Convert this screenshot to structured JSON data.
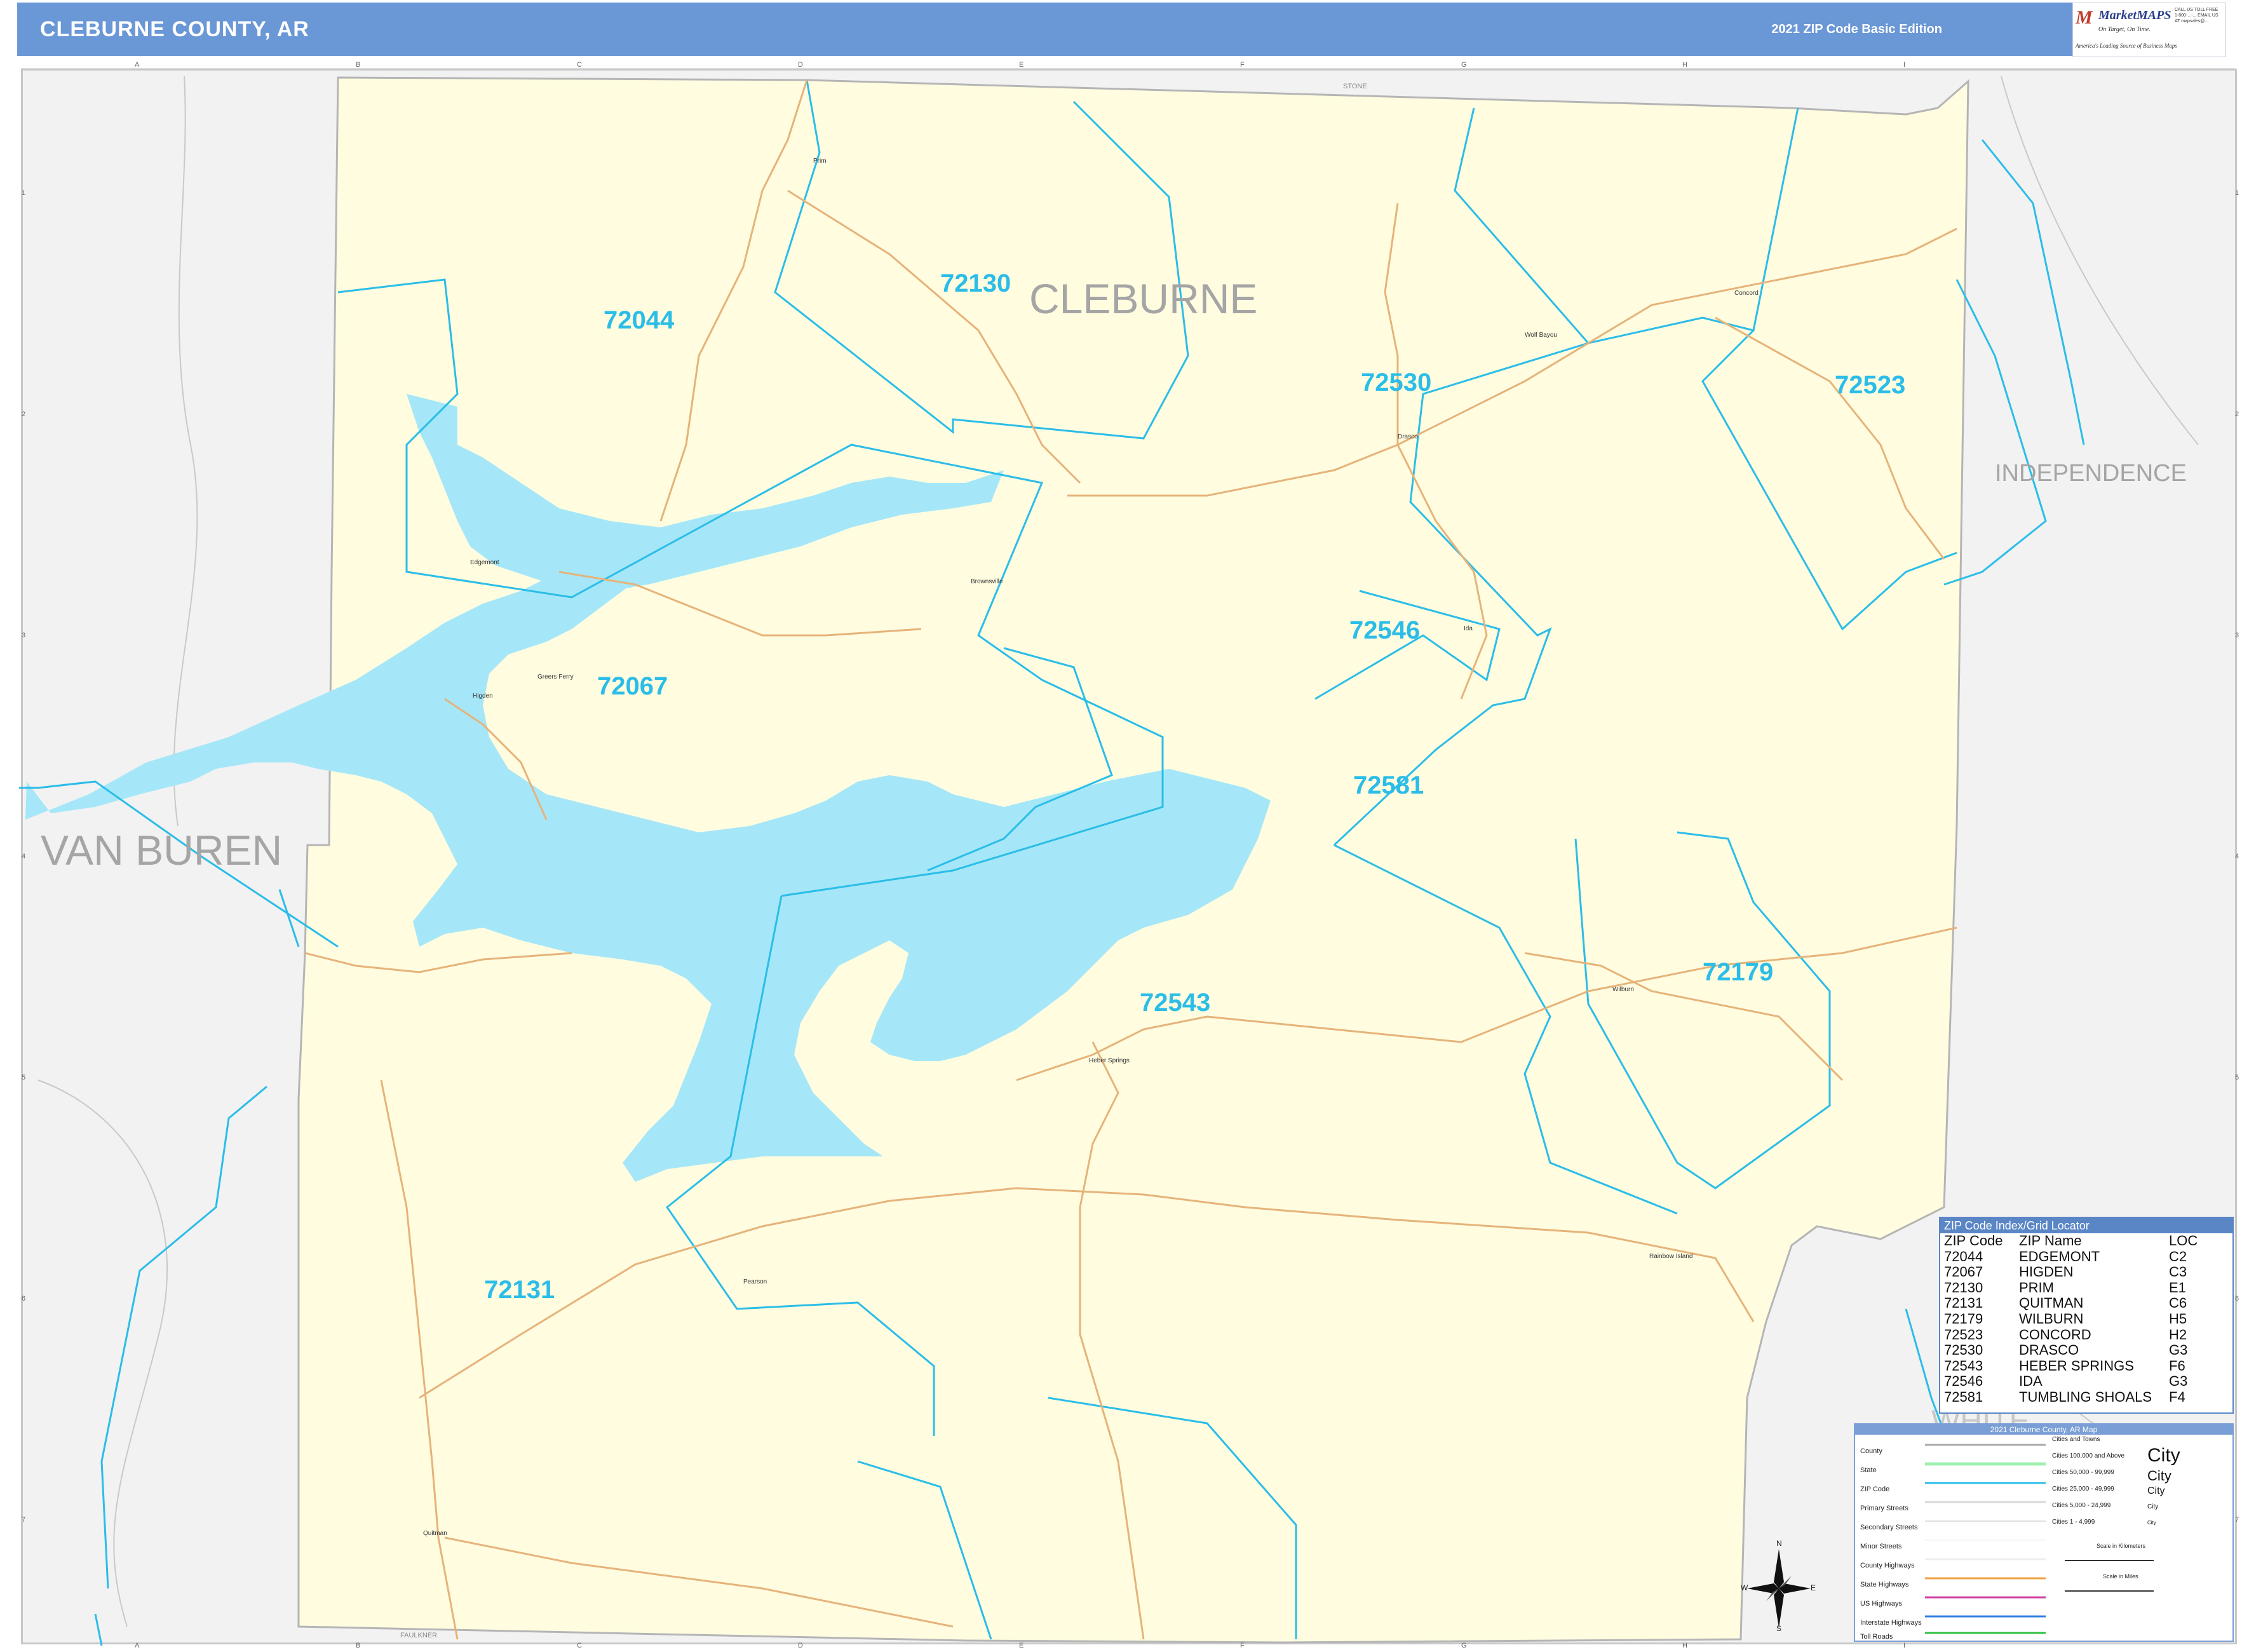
{
  "header": {
    "title": "CLEBURNE COUNTY, AR",
    "edition": "2021 ZIP Code Basic Edition"
  },
  "logo": {
    "brand": "MarketMAPS",
    "tagline": "On Target, On Time.",
    "tagline2": "America's Leading Source of Business Maps",
    "contact": "CALL US TOLL FREE 1-800-...-... EMAIL US AT mapsales@..."
  },
  "grid": {
    "columns": [
      "A",
      "B",
      "C",
      "D",
      "E",
      "F",
      "G",
      "H",
      "I"
    ],
    "rows": [
      "1",
      "2",
      "3",
      "4",
      "5",
      "6",
      "7"
    ]
  },
  "map": {
    "county_labels": {
      "main": "CLEBURNE",
      "west": "VAN BUREN",
      "east": "INDEPENDENCE",
      "southeast": "WHITE"
    },
    "border_labels": {
      "north": "STONE",
      "south": "FAULKNER"
    },
    "zip_labels": [
      "72044",
      "72130",
      "72530",
      "72523",
      "72067",
      "72546",
      "72581",
      "72543",
      "72179",
      "72131"
    ],
    "places": [
      "Prim",
      "Concord",
      "Wolf Bayou",
      "Drasco",
      "Edgemont",
      "Brownsville",
      "Ida",
      "Greers Ferry",
      "Higden",
      "Wilburn",
      "Heber Springs",
      "Pearson",
      "Rainbow Island",
      "Quitman"
    ]
  },
  "zip_index": {
    "title": "ZIP Code Index/Grid Locator",
    "headers": [
      "ZIP Code",
      "ZIP Name",
      "LOC"
    ],
    "rows": [
      [
        "72044",
        "EDGEMONT",
        "C2"
      ],
      [
        "72067",
        "HIGDEN",
        "C3"
      ],
      [
        "72130",
        "PRIM",
        "E1"
      ],
      [
        "72131",
        "QUITMAN",
        "C6"
      ],
      [
        "72179",
        "WILBURN",
        "H5"
      ],
      [
        "72523",
        "CONCORD",
        "H2"
      ],
      [
        "72530",
        "DRASCO",
        "G3"
      ],
      [
        "72543",
        "HEBER SPRINGS",
        "F6"
      ],
      [
        "72546",
        "IDA",
        "G3"
      ],
      [
        "72581",
        "TUMBLING SHOALS",
        "F4"
      ]
    ]
  },
  "legend": {
    "title": "2021 Cleburne County, AR Map",
    "items": [
      "County",
      "State",
      "ZIP Code",
      "Primary Streets",
      "Secondary Streets",
      "Minor Streets",
      "County Highways",
      "State Highways",
      "US Highways",
      "Interstate Highways",
      "Toll Roads"
    ],
    "cities_heading": "Cities and Towns",
    "city_classes": [
      "Cities 100,000 and Above",
      "Cities 50,000 - 99,999",
      "Cities 25,000 - 49,999",
      "Cities 5,000 - 24,999",
      "Cities 1 - 4,999"
    ],
    "city_sample": "City",
    "scale_km": "Scale in Kilometers",
    "scale_mi": "Scale in Miles"
  },
  "compass": {
    "n": "N",
    "s": "S",
    "e": "E",
    "w": "W"
  },
  "colors": {
    "header": "#6a97d6",
    "county_fill": "#fffce0",
    "water": "#a5e7f8",
    "zip_boundary": "#2bbde8",
    "zip_label": "#2bbde8",
    "roads": "#e6b37a"
  }
}
